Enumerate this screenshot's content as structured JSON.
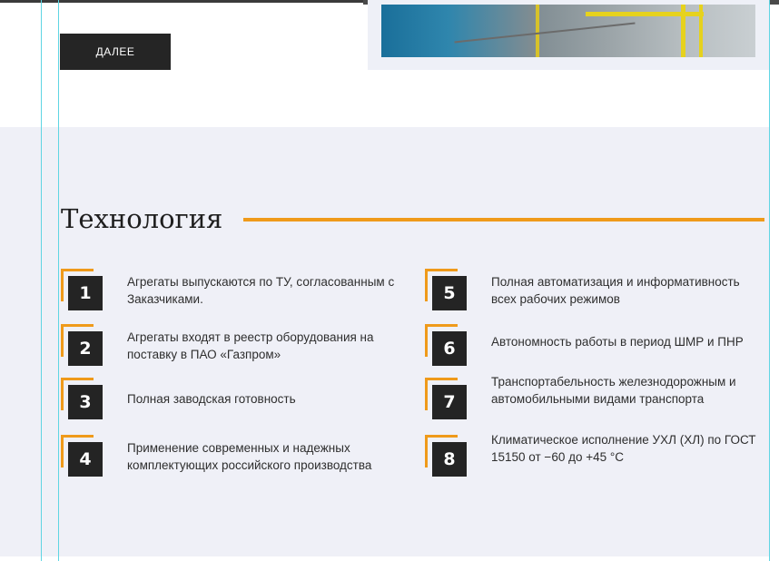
{
  "hero": {
    "button_label": "ДАЛЕЕ"
  },
  "technology": {
    "title": "Технология",
    "accent_color": "#ef9a1a",
    "features": [
      {
        "number": "1",
        "text": "Агрегаты выпускаются по ТУ, согласованным с Заказчиками."
      },
      {
        "number": "2",
        "text": "Агрегаты входят в реестр оборудования на поставку в ПАО «Газпром»"
      },
      {
        "number": "3",
        "text": "Полная заводская готовность"
      },
      {
        "number": "4",
        "text": "Применение современных и надежных комплектующих российского производства"
      },
      {
        "number": "5",
        "text": "Полная автоматизация и информативность всех рабочих режимов"
      },
      {
        "number": "6",
        "text": "Автономность работы в период ШМР и ПНР"
      },
      {
        "number": "7",
        "text": "Транспортабельность железнодорожным и автомобильными видами транспорта"
      },
      {
        "number": "8",
        "text": "Климатическое исполнение УХЛ (ХЛ) по ГОСТ 15150 от −60 до +45 °С"
      }
    ]
  }
}
